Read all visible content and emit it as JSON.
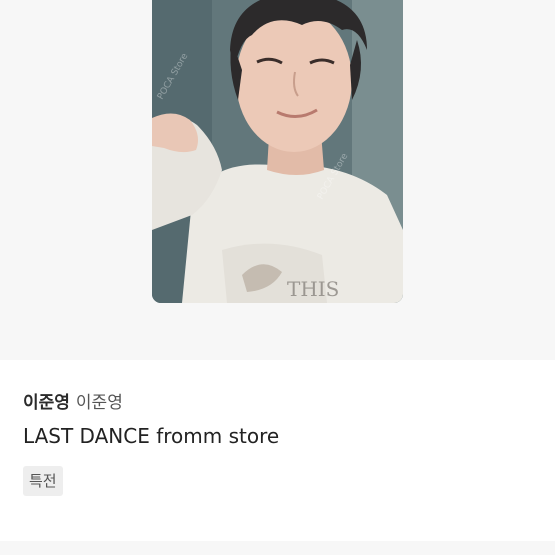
{
  "product": {
    "photocard_alt": "photocard",
    "name_primary": "이준영",
    "name_secondary": "이준영",
    "title": "LAST DANCE fromm store",
    "tag": "특전"
  }
}
